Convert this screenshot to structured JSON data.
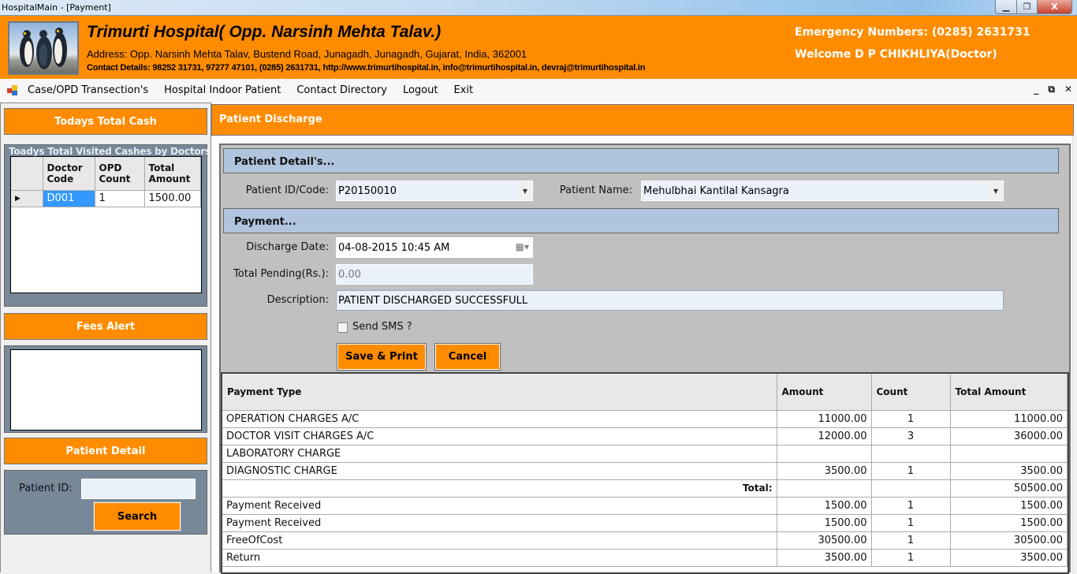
{
  "window": {
    "title": "HospitalMain - [Payment]",
    "controls": {
      "minimize": "—",
      "restore": "⧉",
      "close": "X"
    }
  },
  "header": {
    "hospital_name": "Trimurti Hospital( Opp. Narsinh Mehta Talav.)",
    "address": "Address: Opp. Narsinh Mehta Talav, Bustend Road, Junagadh, Junagadh, Gujarat, India, 362001",
    "contact": "Contact Details: 98252 31731, 97277 47101, (0285) 2631731, http://www.trimurtihospital.in, info@trimurtihospital.in, devraj@trimurtihospital.in",
    "emergency": "Emergency Numbers: (0285) 2631731",
    "welcome": "Welcome D P CHIKHLIYA(Doctor)"
  },
  "menu": {
    "items": [
      "Case/OPD Transection's",
      "Hospital Indoor Patient",
      "Contact Directory",
      "Logout",
      "Exit"
    ],
    "mdi_controls": {
      "minimize": "_",
      "restore": "🗗",
      "close": "✕"
    }
  },
  "sidebar": {
    "cash_title": "Todays Total Cash",
    "doctors_caption": "Toadys Total Visited Cashes by Doctors",
    "doctors_columns": [
      "Doctor Code",
      "OPD Count",
      "Total Amount"
    ],
    "doctors_rows": [
      {
        "code": "D001",
        "count": "1",
        "amount": "1500.00"
      }
    ],
    "fees_alert_title": "Fees Alert",
    "patient_detail_title": "Patient Detail",
    "patient_id_label": "Patient ID:",
    "patient_id_value": "",
    "search_label": "Search"
  },
  "main": {
    "title": "Patient Discharge",
    "patient_section": "Patient Detail's...",
    "patient_id_label": "Patient ID/Code:",
    "patient_id_value": "P20150010",
    "patient_name_label": "Patient Name:",
    "patient_name_value": "Mehulbhai Kantilal Kansagra",
    "payment_section": "Payment...",
    "discharge_date_label": "Discharge Date:",
    "discharge_date_value": "04-08-2015 10:45 AM",
    "total_pending_label": "Total Pending(Rs.):",
    "total_pending_value": "0.00",
    "description_label": "Description:",
    "description_value": "PATIENT DISCHARGED SUCCESSFULL",
    "send_sms_label": "Send SMS ?",
    "send_sms_checked": false,
    "save_print_label": "Save & Print",
    "cancel_label": "Cancel",
    "payment_columns": [
      "Payment Type",
      "Amount",
      "Count",
      "Total Amount"
    ],
    "payment_rows": [
      {
        "type": "OPERATION CHARGES A/C",
        "amount": "11000.00",
        "count": "1",
        "total": "11000.00"
      },
      {
        "type": "DOCTOR VISIT CHARGES A/C",
        "amount": "12000.00",
        "count": "3",
        "total": "36000.00"
      },
      {
        "type": "LABORATORY CHARGE",
        "amount": "",
        "count": "",
        "total": ""
      },
      {
        "type": "DIAGNOSTIC CHARGE",
        "amount": "3500.00",
        "count": "1",
        "total": "3500.00"
      },
      {
        "type": "",
        "label": "Total:",
        "amount": "",
        "count": "",
        "total": "50500.00"
      },
      {
        "type": "Payment Received",
        "amount": "1500.00",
        "count": "1",
        "total": "1500.00"
      },
      {
        "type": "Payment Received",
        "amount": "1500.00",
        "count": "1",
        "total": "1500.00"
      },
      {
        "type": "FreeOfCost",
        "amount": "30500.00",
        "count": "1",
        "total": "30500.00"
      },
      {
        "type": "Return",
        "amount": "3500.00",
        "count": "1",
        "total": "3500.00"
      }
    ]
  },
  "colors": {
    "accent_orange": "#ff8c00",
    "section_blue": "#b0c4de",
    "slate_panel": "#778899",
    "selection_blue": "#3399ff"
  }
}
